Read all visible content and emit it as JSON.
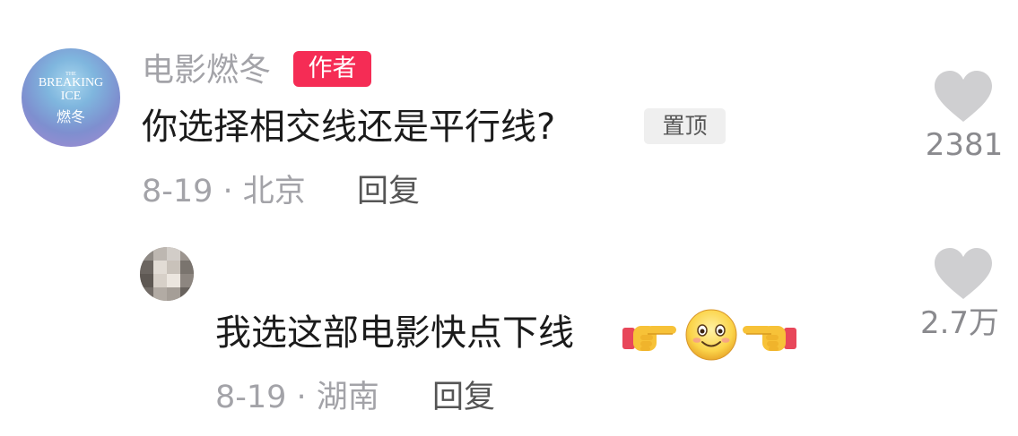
{
  "comment": {
    "username": "电影燃冬",
    "author_badge": "作者",
    "text": "你选择相交线还是平行线?",
    "pinned_badge": "置顶",
    "meta": "8-19 · 北京",
    "reply_label": "回复",
    "like_count": "2381",
    "avatar_logo": {
      "line1": "THE",
      "line2": "BREAKING",
      "line3": "ICE",
      "line4": "燃冬"
    }
  },
  "reply": {
    "username": "",
    "text": "我选这部电影快点下线",
    "emojis": [
      "point-right-icon",
      "smile-icon",
      "point-left-icon"
    ],
    "meta": "8-19 · 湖南",
    "reply_label": "回复",
    "like_count": "2.7万"
  },
  "colors": {
    "author_badge": "#f52c55",
    "secondary_text": "#a3a3a8",
    "primary_text": "#1b1b1b",
    "heart": "#cfcfd1"
  }
}
